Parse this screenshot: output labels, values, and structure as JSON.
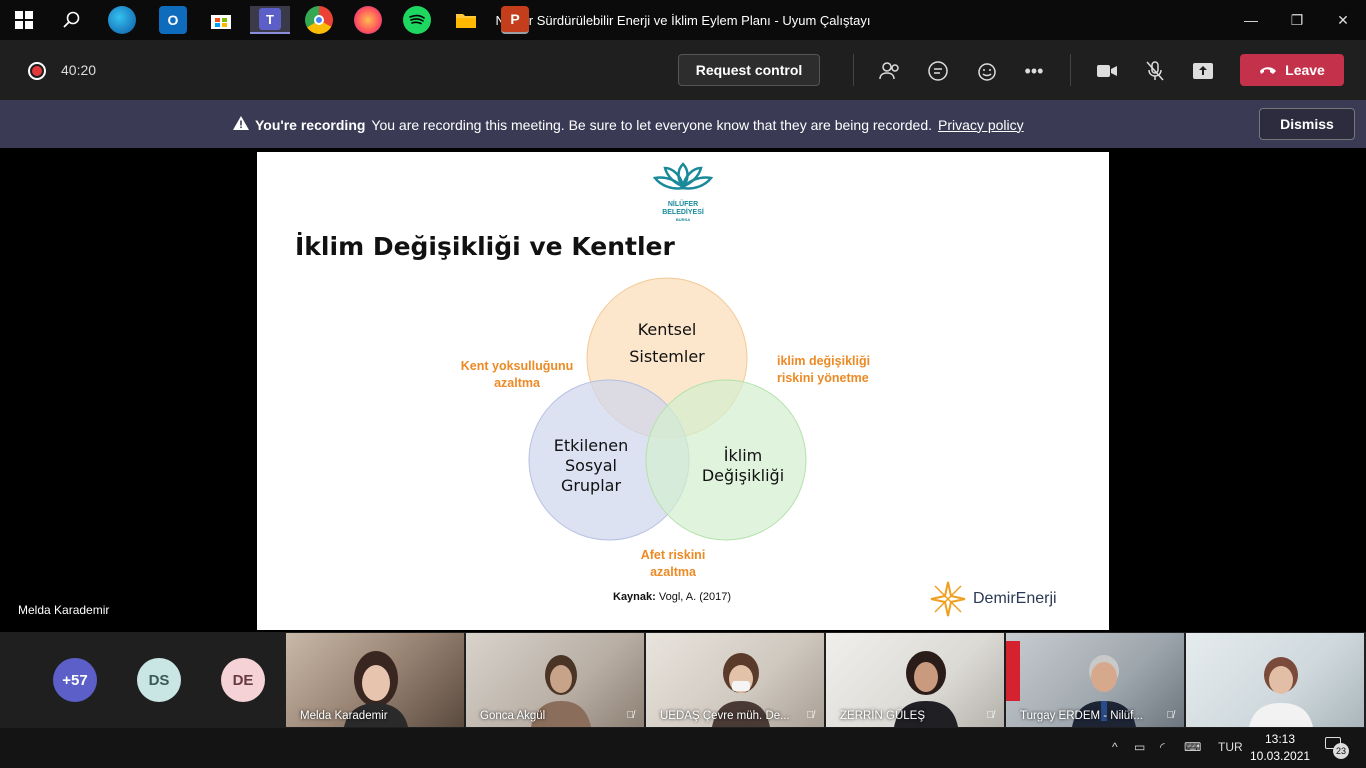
{
  "window": {
    "title": "Nilüfer Sürdürülebilir Enerji ve İklim Eylem Planı - Uyum Çalıştayı",
    "minimize_icon": "minimize-icon",
    "maximize_icon": "restore-icon",
    "close_icon": "close-icon"
  },
  "meeting_bar": {
    "timer": "40:20",
    "request_control_label": "Request control",
    "leave_label": "Leave",
    "icons": [
      "participants-icon",
      "chat-icon",
      "reactions-icon",
      "more-icon",
      "camera-icon",
      "mic-off-icon",
      "share-icon"
    ]
  },
  "recording_banner": {
    "title": "You're recording",
    "message": "You are recording this meeting. Be sure to let everyone know that they are being recorded.",
    "link": "Privacy policy",
    "dismiss_label": "Dismiss"
  },
  "stage": {
    "presenter_name": "Melda Karademir"
  },
  "slide": {
    "logo_line1": "NİLÜFER",
    "logo_line2": "BELEDİYESİ",
    "logo_line3": "BURSA",
    "title": "İklim Değişikliği ve Kentler",
    "circle_top_line1": "Kentsel",
    "circle_top_line2": "Sistemler",
    "circle_left_line1": "Etkilenen",
    "circle_left_line2": "Sosyal",
    "circle_left_line3": "Gruplar",
    "circle_right_line1": "İklim",
    "circle_right_line2": "Değişikliği",
    "label_left_line1": "Kent yoksulluğunu",
    "label_left_line2": "azaltma",
    "label_right_line1": "iklim değişikliği",
    "label_right_line2": "riskini yönetme",
    "label_bottom_line1": "Afet riskini",
    "label_bottom_line2": "azaltma",
    "source_label": "Kaynak:",
    "source_value": "Vogl, A. (2017)",
    "brand": "DemirEnerji",
    "colors": {
      "circle_top": "#fbe3c4",
      "circle_left": "#cfd6ee",
      "circle_right": "#d3efce",
      "accent_orange": "#ec8a25"
    }
  },
  "gallery": {
    "overflow_count": "+57",
    "avatars": [
      {
        "initials": "DS",
        "color": "#c9e6e4",
        "text_color": "#3a5a5a"
      },
      {
        "initials": "DE",
        "color": "#f5d2d6",
        "text_color": "#6a3a42"
      }
    ],
    "tiles": [
      {
        "name": "Melda Karademir",
        "muted": false
      },
      {
        "name": "Gonca Akgül",
        "muted": true
      },
      {
        "name": "UEDAŞ Çevre müh. De...",
        "muted": true
      },
      {
        "name": "ZERRİN GÜLEŞ",
        "muted": true
      },
      {
        "name": "Turgay ERDEM - Nilüf...",
        "muted": true
      },
      {
        "name": "",
        "muted": false
      }
    ]
  },
  "taskbar": {
    "apps": [
      "windows-start-icon",
      "search-icon",
      "edge-icon",
      "outlook-icon",
      "store-icon",
      "teams-icon",
      "chrome-icon",
      "firefox-icon",
      "spotify-icon",
      "file-explorer-icon",
      "powerpoint-icon"
    ],
    "language": "TUR",
    "time": "13:13",
    "date": "10.03.2021",
    "notification_count": "23"
  }
}
